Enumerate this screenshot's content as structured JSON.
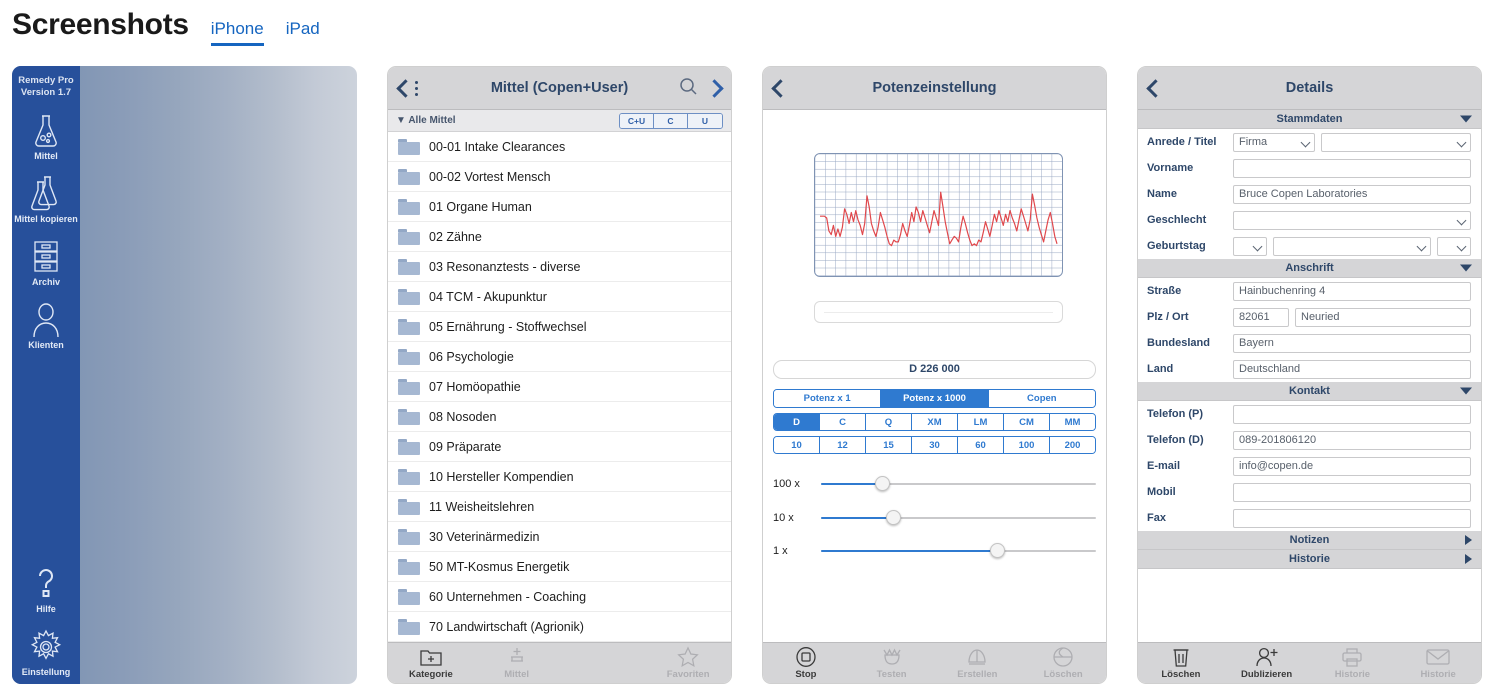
{
  "header": {
    "title": "Screenshots",
    "tabs": [
      {
        "label": "iPhone",
        "active": true
      },
      {
        "label": "iPad",
        "active": false
      }
    ]
  },
  "panel1": {
    "app_name": "Remedy Pro",
    "version": "Version 1.7",
    "rail_items": [
      {
        "icon": "flask-icon",
        "label": "Mittel"
      },
      {
        "icon": "flask-copy-icon",
        "label": "Mittel kopieren"
      },
      {
        "icon": "archive-drawers-icon",
        "label": "Archiv"
      },
      {
        "icon": "person-icon",
        "label": "Klienten"
      }
    ],
    "rail_bottom": [
      {
        "icon": "question-mark-icon",
        "label": "Hilfe"
      },
      {
        "icon": "gear-icon",
        "label": "Einstellung"
      }
    ]
  },
  "panel2": {
    "nav": {
      "title": "Mittel (Copen+User)",
      "back_icon": "back-chevron-icon",
      "menu_icon": "dots-icon",
      "search_icon": "search-icon",
      "forward_icon": "forward-chevron-icon"
    },
    "filter": {
      "label": "Alle Mittel",
      "disclosure_icon": "triangle-down-icon",
      "segments": [
        "C+U",
        "C",
        "U"
      ]
    },
    "items": [
      "00-01 Intake Clearances",
      "00-02 Vortest Mensch",
      "01 Organe Human",
      "02 Zähne",
      "03 Resonanztests - diverse",
      "04 TCM - Akupunktur",
      "05 Ernährung - Stoffwechsel",
      "06 Psychologie",
      "07 Homöopathie",
      "08 Nosoden",
      "09 Präparate",
      "10 Hersteller Kompendien",
      "11 Weisheitslehren",
      "30 Veterinärmedizin",
      "50 MT-Kosmus Energetik",
      "60 Unternehmen - Coaching",
      "70 Landwirtschaft (Agrionik)"
    ],
    "toolbar": [
      {
        "icon": "folder-plus-icon",
        "label": "Kategorie",
        "dim": false
      },
      {
        "icon": "vial-plus-icon",
        "label": "Mittel",
        "dim": true
      },
      {
        "icon": "spacer",
        "label": "",
        "dim": true
      },
      {
        "icon": "star-icon",
        "label": "Favoriten",
        "dim": true
      }
    ]
  },
  "panel3": {
    "nav": {
      "title": "Potenzeinstellung",
      "back_icon": "back-chevron-icon"
    },
    "input_value": "",
    "potency_value": "D 226 000",
    "row1": {
      "options": [
        "Potenz x 1",
        "Potenz x 1000",
        "Copen"
      ],
      "selected": "Potenz x 1000"
    },
    "row2": {
      "options": [
        "D",
        "C",
        "Q",
        "XM",
        "LM",
        "CM",
        "MM"
      ],
      "selected": "D"
    },
    "row3": {
      "options": [
        "10",
        "12",
        "15",
        "30",
        "60",
        "100",
        "200"
      ],
      "selected": ""
    },
    "sliders": [
      {
        "label": "100 x",
        "percent": 22
      },
      {
        "label": "10  x",
        "percent": 26
      },
      {
        "label": "1  x",
        "percent": 64
      }
    ],
    "toolbar": [
      {
        "icon": "stop-square-icon",
        "label": "Stop",
        "dim": false
      },
      {
        "icon": "test-crown-icon",
        "label": "Testen",
        "dim": true
      },
      {
        "icon": "create-upload-icon",
        "label": "Erstellen",
        "dim": true
      },
      {
        "icon": "delete-circle-icon",
        "label": "Löschen",
        "dim": true
      }
    ]
  },
  "panel4": {
    "nav": {
      "title": "Details",
      "back_icon": "back-chevron-icon"
    },
    "sections": [
      {
        "title": "Stammdaten",
        "arrow": "triangle-down-icon",
        "rows": [
          {
            "label": "Anrede / Titel",
            "type": "select-select",
            "value1": "Firma",
            "value2": ""
          },
          {
            "label": "Vorname",
            "type": "input",
            "value": ""
          },
          {
            "label": "Name",
            "type": "input",
            "value": "Bruce Copen Laboratories"
          },
          {
            "label": "Geschlecht",
            "type": "select",
            "value": ""
          },
          {
            "label": "Geburtstag",
            "type": "date",
            "value": ""
          }
        ]
      },
      {
        "title": "Anschrift",
        "arrow": "triangle-down-icon",
        "rows": [
          {
            "label": "Straße",
            "type": "input",
            "value": "Hainbuchenring 4"
          },
          {
            "label": "Plz / Ort",
            "type": "input-input",
            "value1": "82061",
            "value2": "Neuried"
          },
          {
            "label": "Bundesland",
            "type": "input",
            "value": "Bayern"
          },
          {
            "label": "Land",
            "type": "input",
            "value": "Deutschland"
          }
        ]
      },
      {
        "title": "Kontakt",
        "arrow": "triangle-down-icon",
        "rows": [
          {
            "label": "Telefon (P)",
            "type": "input",
            "value": ""
          },
          {
            "label": "Telefon (D)",
            "type": "input",
            "value": "089-201806120"
          },
          {
            "label": "E-mail",
            "type": "input",
            "value": "info@copen.de"
          },
          {
            "label": "Mobil",
            "type": "input",
            "value": ""
          },
          {
            "label": "Fax",
            "type": "input",
            "value": ""
          }
        ]
      },
      {
        "title": "Notizen",
        "arrow": "triangle-right-icon",
        "rows": []
      },
      {
        "title": "Historie",
        "arrow": "triangle-right-icon",
        "rows": []
      }
    ],
    "toolbar": [
      {
        "icon": "trash-icon",
        "label": "Löschen",
        "dim": false
      },
      {
        "icon": "person-plus-icon",
        "label": "Dublizieren",
        "dim": false
      },
      {
        "icon": "printer-icon",
        "label": "Historie",
        "dim": true
      },
      {
        "icon": "envelope-icon",
        "label": "Historie",
        "dim": true
      }
    ]
  },
  "chart_data": {
    "type": "line",
    "title": "",
    "xlabel": "",
    "ylabel": "",
    "grid": true,
    "legend": "none",
    "series": [
      {
        "name": "signal",
        "color": "#e0484c",
        "values": [
          52,
          52,
          52,
          50,
          36,
          32,
          42,
          30,
          38,
          30,
          40,
          60,
          54,
          44,
          56,
          46,
          58,
          48,
          42,
          32,
          44,
          74,
          62,
          44,
          36,
          30,
          40,
          56,
          48,
          40,
          30,
          22,
          20,
          26,
          24,
          24,
          32,
          44,
          36,
          30,
          42,
          56,
          46,
          62,
          56,
          46,
          58,
          50,
          42,
          34,
          46,
          58,
          50,
          42,
          78,
          62,
          46,
          34,
          22,
          26,
          30,
          28,
          24,
          40,
          52,
          44,
          34,
          26,
          20,
          22,
          20,
          26,
          24,
          34,
          46,
          38,
          30,
          42,
          54,
          46,
          58,
          50,
          42,
          54,
          46,
          58,
          50,
          44,
          36,
          48,
          60,
          52,
          44,
          36,
          48,
          76,
          64,
          50,
          40,
          32,
          24,
          36,
          48,
          56,
          44,
          30,
          22
        ]
      }
    ],
    "ylim": [
      0,
      100
    ],
    "xlim": [
      0,
      106
    ]
  }
}
